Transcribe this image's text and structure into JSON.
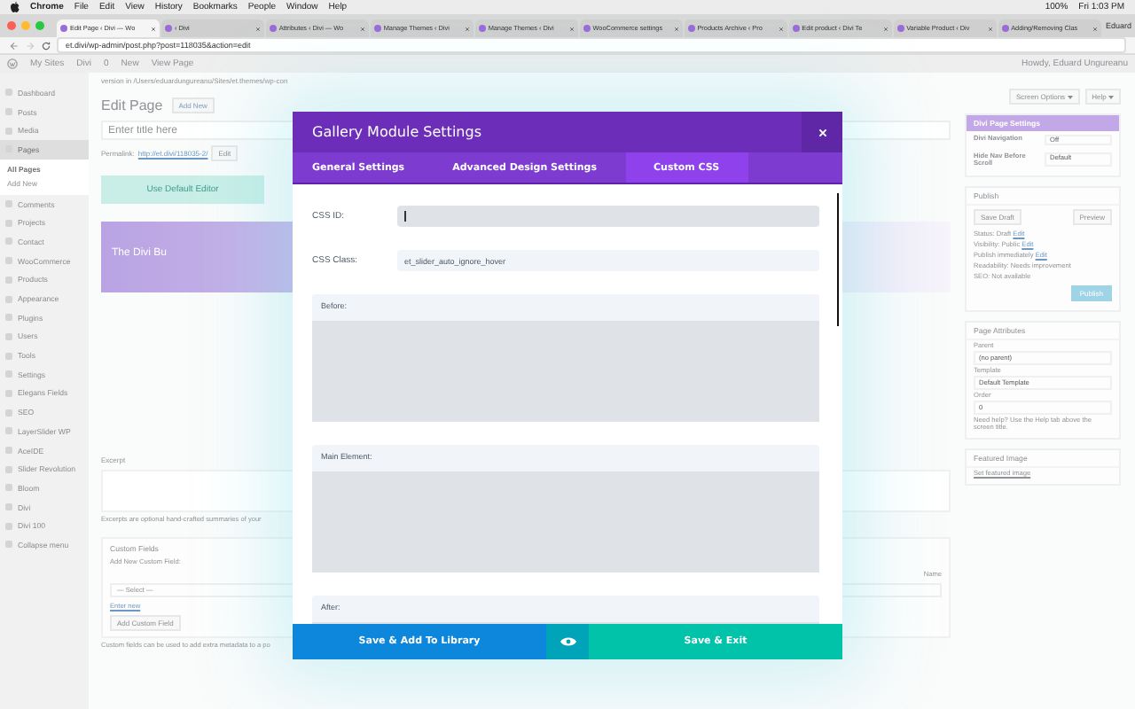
{
  "menubar": {
    "app": "Chrome",
    "menus": [
      "File",
      "Edit",
      "View",
      "History",
      "Bookmarks",
      "People",
      "Window",
      "Help"
    ],
    "status": [
      "100%",
      "Fri 1:03 PM"
    ]
  },
  "browser": {
    "tabs": [
      {
        "title": "Edit Page ‹ Divi — Wo",
        "selected": true
      },
      {
        "title": "‹ Divi",
        "selected": false
      },
      {
        "title": "Attributes ‹ Divi — Wo",
        "selected": false
      },
      {
        "title": "Manage Themes ‹ Divi",
        "selected": false
      },
      {
        "title": "Manage Themes ‹ Divi",
        "selected": false
      },
      {
        "title": "WooCommerce settings",
        "selected": false
      },
      {
        "title": "Products Archive ‹ Pro",
        "selected": false
      },
      {
        "title": "Edit product ‹ Divi Te",
        "selected": false
      },
      {
        "title": "Variable Product ‹ Div",
        "selected": false
      },
      {
        "title": "Adding/Removing Clas",
        "selected": false
      }
    ],
    "profile": "Eduard",
    "url": "et.divi/wp-admin/post.php?post=118035&action=edit"
  },
  "admin_bar": {
    "items": [
      "My Sites",
      "Divi",
      "0",
      "New",
      "View Page"
    ],
    "greeting": "Howdy, Eduard Ungureanu"
  },
  "sidebar": {
    "items": [
      {
        "label": "Dashboard",
        "selected": false
      },
      {
        "label": "Posts",
        "selected": false
      },
      {
        "label": "Media",
        "selected": false
      },
      {
        "label": "Pages",
        "selected": true,
        "children": [
          {
            "label": "All Pages",
            "selected": true
          },
          {
            "label": "Add New",
            "selected": false
          }
        ]
      },
      {
        "label": "Comments",
        "selected": false
      },
      {
        "label": "Projects",
        "selected": false
      },
      {
        "label": "Contact",
        "selected": false
      },
      {
        "label": "WooCommerce",
        "selected": false
      },
      {
        "label": "Products",
        "selected": false
      },
      {
        "label": "Appearance",
        "selected": false
      },
      {
        "label": "Plugins",
        "selected": false
      },
      {
        "label": "Users",
        "selected": false
      },
      {
        "label": "Tools",
        "selected": false
      },
      {
        "label": "Settings",
        "selected": false
      },
      {
        "label": "Elegans Fields",
        "selected": false
      },
      {
        "label": "SEO",
        "selected": false
      },
      {
        "label": "LayerSlider WP",
        "selected": false
      },
      {
        "label": "AceIDE",
        "selected": false
      },
      {
        "label": "Slider Revolution",
        "selected": false
      },
      {
        "label": "Bloom",
        "selected": false
      },
      {
        "label": "Divi",
        "selected": false
      },
      {
        "label": "Divi 100",
        "selected": false
      },
      {
        "label": "Collapse menu",
        "selected": false
      }
    ]
  },
  "page": {
    "notice": "version in /Users/eduardungureanu/Sites/et.themes/wp-con",
    "heading": "Edit Page",
    "add_new": "Add New",
    "title_placeholder": "Enter title here",
    "permalink_label": "Permalink:",
    "permalink": "http://et.divi/118035-2/",
    "permalink_edit": "Edit",
    "default_editor": "Use Default Editor",
    "builder_title": "The Divi Bu",
    "excerpt": "Excerpt",
    "excerpt_help": "Excerpts are optional hand-crafted summaries of your",
    "custom_fields": "Custom Fields",
    "add_custom": "Add New Custom Field:",
    "name_col": "Name",
    "select": "— Select —",
    "enter_new": "Enter new",
    "add_button": "Add Custom Field",
    "custom_help": "Custom fields can be used to add extra metadata to a po"
  },
  "right": {
    "screen_options": "Screen Options",
    "help": "Help",
    "divi_settings": {
      "title": "Divi Page Settings",
      "fields": [
        {
          "label": "Divi Navigation",
          "value": "Off"
        },
        {
          "label": "Hide Nav Before Scroll",
          "value": "Default"
        }
      ]
    },
    "publish": {
      "title": "Publish",
      "save_draft": "Save Draft",
      "preview": "Preview",
      "lines": [
        {
          "text": "Status: Draft",
          "link": "Edit"
        },
        {
          "text": "Visibility: Public",
          "link": "Edit"
        },
        {
          "text": "Publish immediately",
          "link": "Edit"
        },
        {
          "text": "Readability: Needs improvement"
        },
        {
          "text": "SEO: Not available"
        }
      ],
      "button": "Publish"
    },
    "attributes": {
      "title": "Page Attributes",
      "fields": [
        {
          "label": "Parent",
          "value": "(no parent)"
        },
        {
          "label": "Template",
          "value": "Default Template"
        },
        {
          "label": "Order",
          "value": "0"
        }
      ],
      "help": "Need help? Use the Help tab above the screen title."
    },
    "featured": {
      "title": "Featured Image",
      "link": "Set featured image"
    }
  },
  "modal": {
    "title": "Gallery Module Settings",
    "tabs": [
      {
        "label": "General Settings",
        "selected": false
      },
      {
        "label": "Advanced Design Settings",
        "selected": false
      },
      {
        "label": "Custom CSS",
        "selected": true
      }
    ],
    "fields": [
      {
        "kind": "input",
        "label": "CSS ID:",
        "focused": true
      },
      {
        "kind": "input",
        "label": "CSS Class:",
        "value": "et_slider_auto_ignore_hover",
        "focused": false
      },
      {
        "kind": "textarea",
        "label": "Before:"
      },
      {
        "kind": "textarea",
        "label": "Main Element:"
      },
      {
        "kind": "textarea",
        "label": "After:"
      }
    ],
    "footer": {
      "library": "Save & Add To Library",
      "exit": "Save & Exit"
    }
  }
}
